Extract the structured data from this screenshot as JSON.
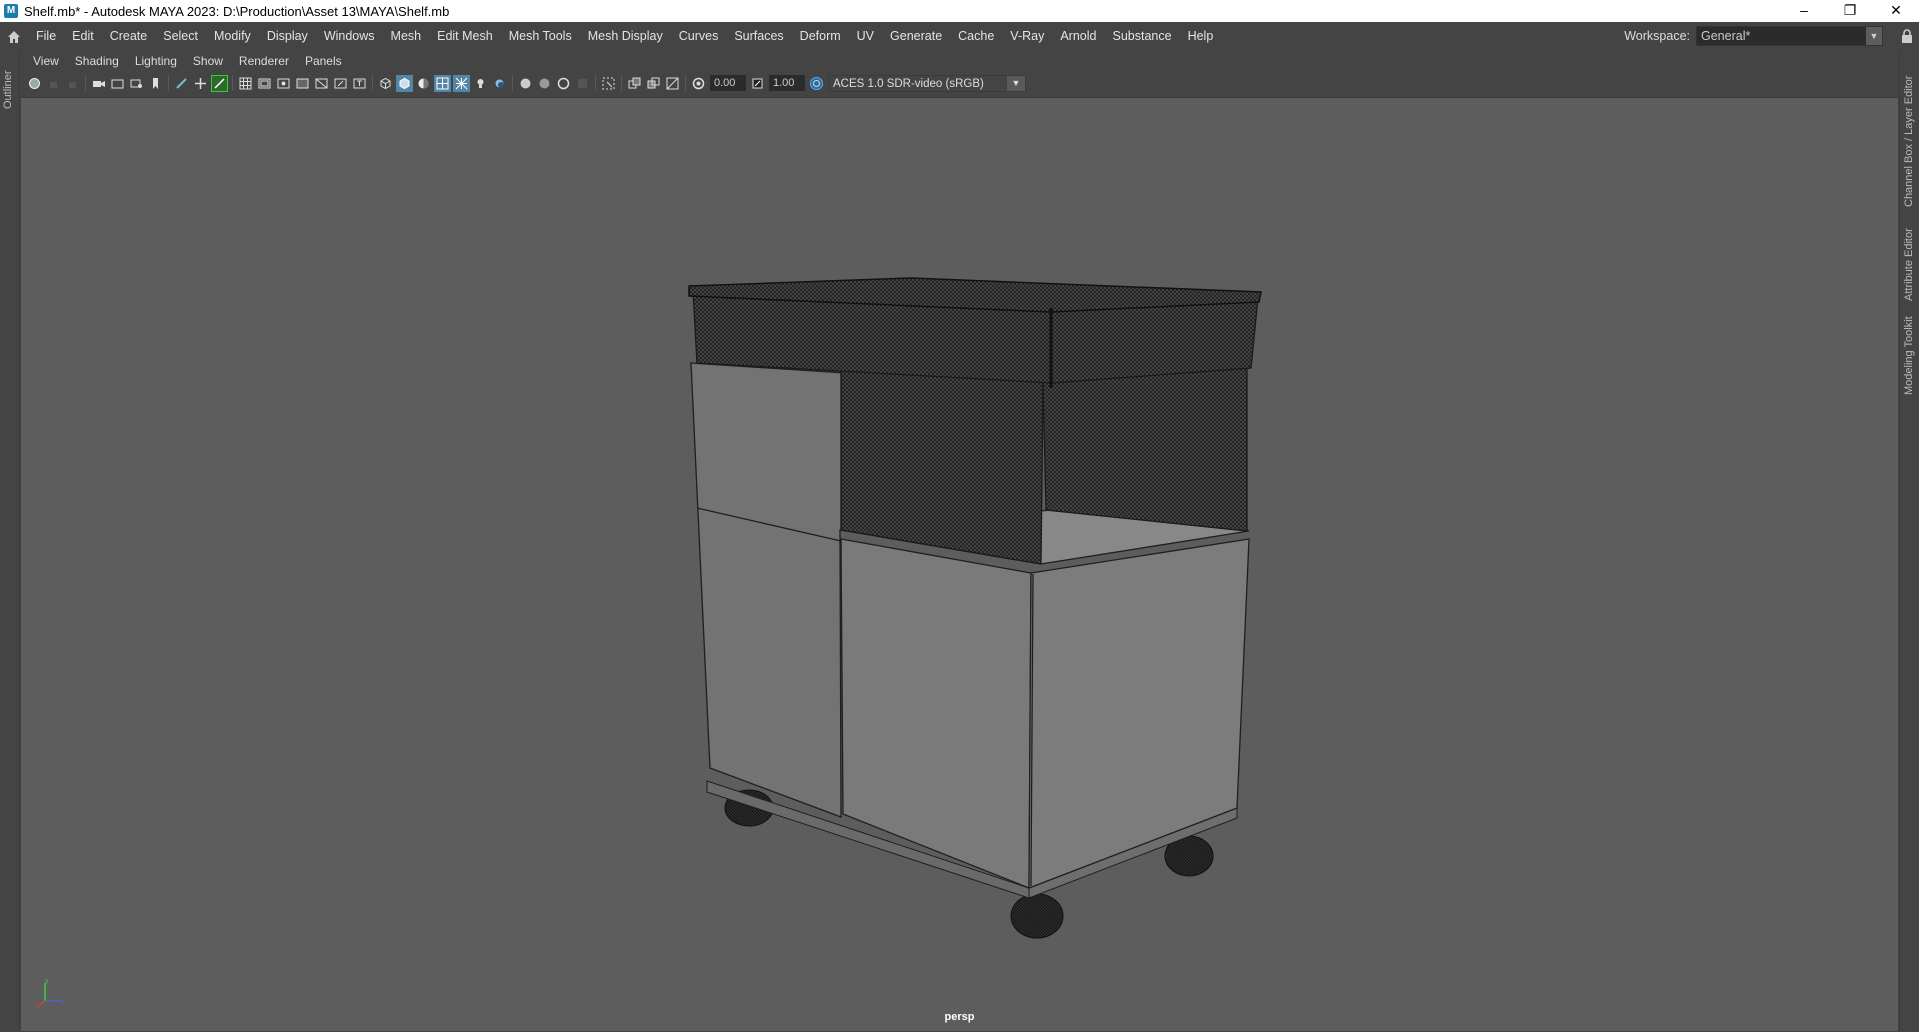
{
  "window": {
    "title": "Shelf.mb* - Autodesk MAYA 2023: D:\\Production\\Asset 13\\MAYA\\Shelf.mb",
    "controls": [
      "–",
      "❐",
      "✕"
    ]
  },
  "menubar": {
    "items": [
      "File",
      "Edit",
      "Create",
      "Select",
      "Modify",
      "Display",
      "Windows",
      "Mesh",
      "Edit Mesh",
      "Mesh Tools",
      "Mesh Display",
      "Curves",
      "Surfaces",
      "Deform",
      "UV",
      "Generate",
      "Cache",
      "V-Ray",
      "Arnold",
      "Substance",
      "Help"
    ]
  },
  "workspace": {
    "label": "Workspace:",
    "value": "General*"
  },
  "side_tabs": {
    "left": [
      "Outliner"
    ],
    "right": [
      "Channel Box / Layer Editor",
      "Attribute Editor",
      "Modeling Toolkit"
    ]
  },
  "panel_menu": {
    "items": [
      "View",
      "Shading",
      "Lighting",
      "Show",
      "Renderer",
      "Panels"
    ]
  },
  "toolbar": {
    "exposure": "0.00",
    "gamma": "1.00",
    "color_space": "ACES 1.0 SDR-video (sRGB)"
  },
  "viewport": {
    "camera_label": "persp",
    "background_color": "#5d5d5d"
  },
  "colors": {
    "accent": "#1a7fa8",
    "viewport_bg": "#5d5d5d",
    "ui_bg": "#444444",
    "highlight_button": "#5285a6",
    "axis_x": "#d23c3c",
    "axis_y": "#3ccf3c",
    "axis_z": "#3c6cd2"
  }
}
